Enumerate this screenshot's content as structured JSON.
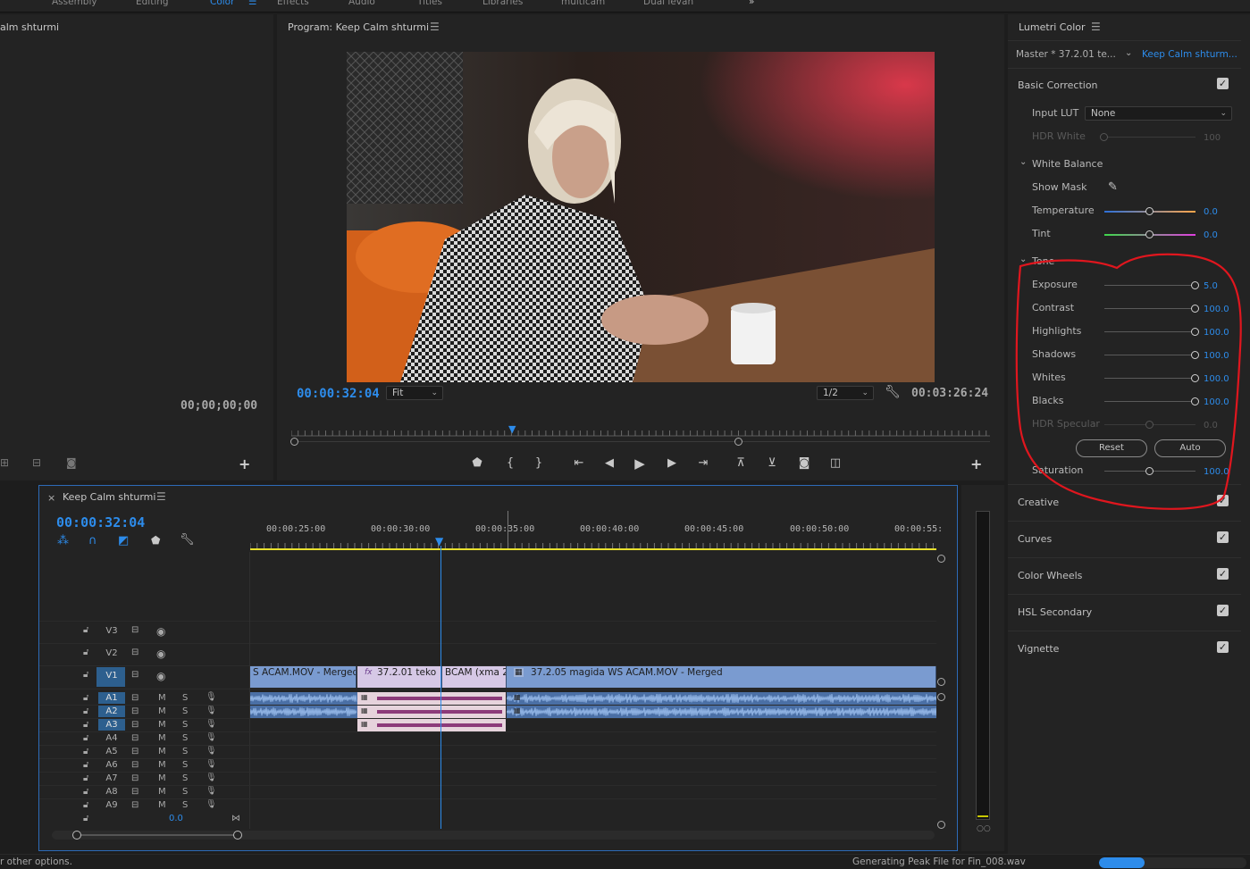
{
  "workspaces": [
    "Assembly",
    "Editing",
    "Color",
    "Effects",
    "Audio",
    "Titles",
    "Libraries",
    "multicam",
    "Dual levan"
  ],
  "workspaces_active": "Color",
  "more_workspaces": "»",
  "source_panel": {
    "title": "alm shturmi",
    "timecode": "00;00;00;00"
  },
  "program": {
    "title": "Program: Keep Calm shturmi",
    "timecode": "00:00:32:04",
    "zoom": "Fit",
    "resolution": "1/2",
    "duration": "00:03:26:24"
  },
  "lumetri": {
    "title": "Lumetri Color",
    "master_clip": "Master * 37.2.01 te...",
    "sequence_clip": "Keep Calm shturm...",
    "basic_correction": "Basic Correction",
    "input_lut_label": "Input LUT",
    "input_lut_value": "None",
    "hdr_white_label": "HDR White",
    "hdr_white_value": "100",
    "white_balance": "White Balance",
    "show_mask": "Show Mask",
    "temperature_label": "Temperature",
    "temperature_value": "0.0",
    "tint_label": "Tint",
    "tint_value": "0.0",
    "tone": "Tone",
    "exposure_label": "Exposure",
    "exposure_value": "5.0",
    "contrast_label": "Contrast",
    "contrast_value": "100.0",
    "highlights_label": "Highlights",
    "highlights_value": "100.0",
    "shadows_label": "Shadows",
    "shadows_value": "100.0",
    "whites_label": "Whites",
    "whites_value": "100.0",
    "blacks_label": "Blacks",
    "blacks_value": "100.0",
    "hdr_specular_label": "HDR Specular",
    "hdr_specular_value": "0.0",
    "reset_label": "Reset",
    "auto_label": "Auto",
    "saturation_label": "Saturation",
    "saturation_value": "100.0",
    "creative": "Creative",
    "curves": "Curves",
    "color_wheels": "Color Wheels",
    "hsl_secondary": "HSL Secondary",
    "vignette": "Vignette",
    "annotation_color": "#e0161e"
  },
  "timeline": {
    "title": "Keep Calm shturmi",
    "close": "×",
    "timecode": "00:00:32:04",
    "ruler": [
      "00:00:25:00",
      "00:00:30:00",
      "00:00:35:00",
      "00:00:40:00",
      "00:00:45:00",
      "00:00:50:00",
      "00:00:55:"
    ],
    "video_tracks": [
      "V3",
      "V2",
      "V1"
    ],
    "audio_tracks": [
      "A1",
      "A2",
      "A3",
      "A4",
      "A5",
      "A6",
      "A7",
      "A8",
      "A9"
    ],
    "mute_label": "M",
    "solo_label": "S",
    "master_value": "0.0",
    "clip_1": "S ACAM.MOV - Merged",
    "clip_2": "37.2.01 teko",
    "clip_3": "BCAM (xma 2(",
    "clip_4": "37.2.05 magida WS ACAM.MOV - Merged",
    "fx": "fx"
  },
  "status": {
    "left": "r other options.",
    "right": "Generating Peak File for Fin_008.wav",
    "progress": 0.31
  },
  "colors": {
    "accent": "#2d8ceb",
    "clip_video": "#7a9bd0",
    "clip_audio": "#4a6fa5",
    "clip_linked": "#e6d3dc",
    "playhead": "#2d8ceb"
  }
}
